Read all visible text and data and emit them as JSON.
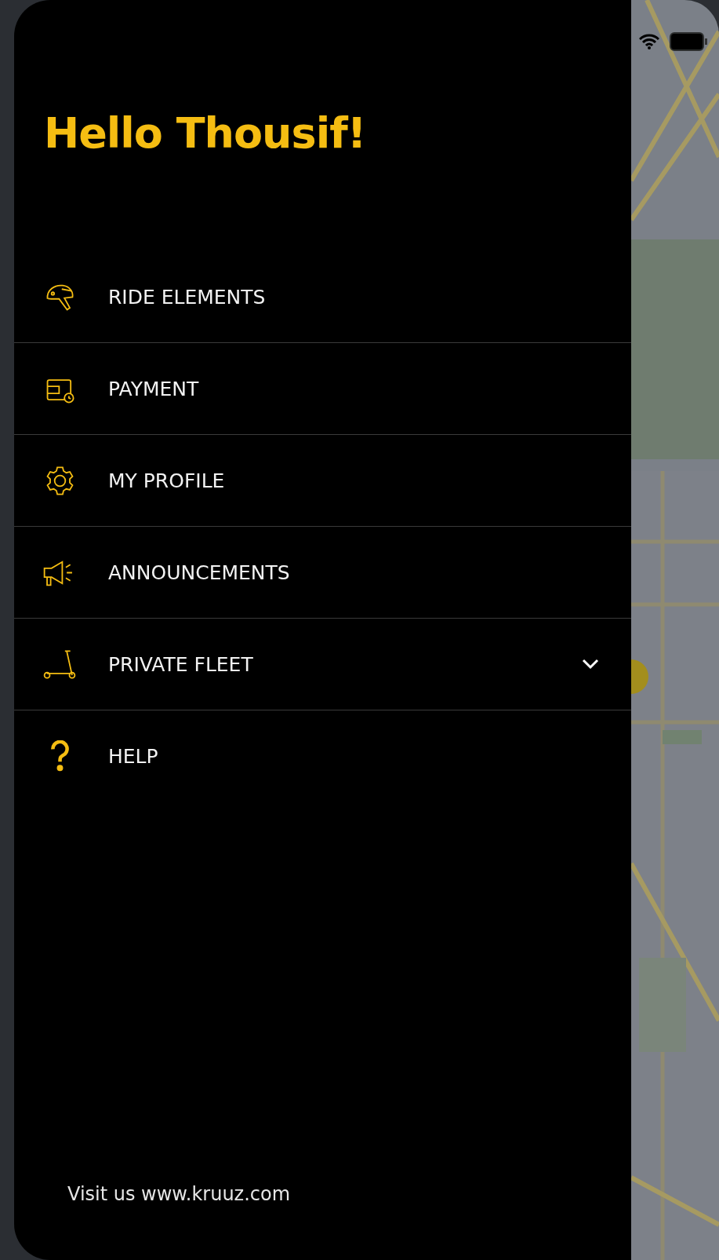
{
  "greeting": "Hello Thousif!",
  "menu": [
    {
      "label": "RIDE ELEMENTS"
    },
    {
      "label": "PAYMENT"
    },
    {
      "label": "MY PROFILE"
    },
    {
      "label": "ANNOUNCEMENTS"
    },
    {
      "label": "PRIVATE FLEET",
      "expanded": false
    },
    {
      "label": "HELP"
    }
  ],
  "footer": "Visit us www.kruuz.com"
}
